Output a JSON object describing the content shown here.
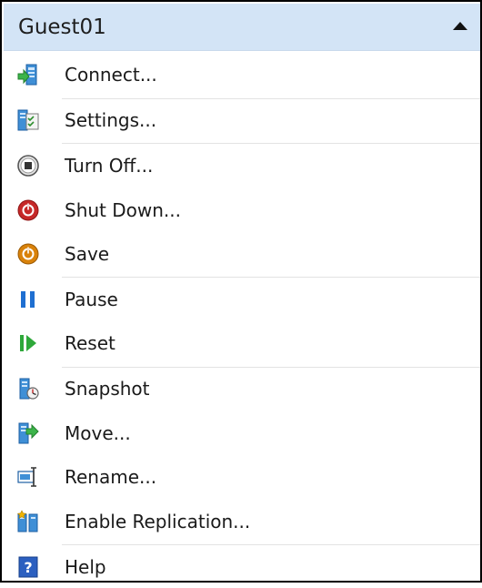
{
  "panel": {
    "title": "Guest01",
    "items": [
      {
        "label": "Connect...",
        "icon": "connect-icon"
      },
      {
        "label": "Settings...",
        "icon": "settings-icon"
      },
      {
        "label": "Turn Off...",
        "icon": "turn-off-icon"
      },
      {
        "label": "Shut Down...",
        "icon": "shut-down-icon"
      },
      {
        "label": "Save",
        "icon": "save-icon"
      },
      {
        "label": "Pause",
        "icon": "pause-icon"
      },
      {
        "label": "Reset",
        "icon": "reset-icon"
      },
      {
        "label": "Snapshot",
        "icon": "snapshot-icon"
      },
      {
        "label": "Move...",
        "icon": "move-icon"
      },
      {
        "label": "Rename...",
        "icon": "rename-icon"
      },
      {
        "label": "Enable Replication...",
        "icon": "enable-replication-icon"
      },
      {
        "label": "Help",
        "icon": "help-icon"
      }
    ]
  },
  "colors": {
    "header_background": "#d3e4f6",
    "shut_down_red": "#c62828",
    "save_orange": "#d9820a",
    "pause_blue": "#1f6fd1",
    "reset_green": "#2ea83a",
    "help_blue": "#2b5fc0"
  }
}
